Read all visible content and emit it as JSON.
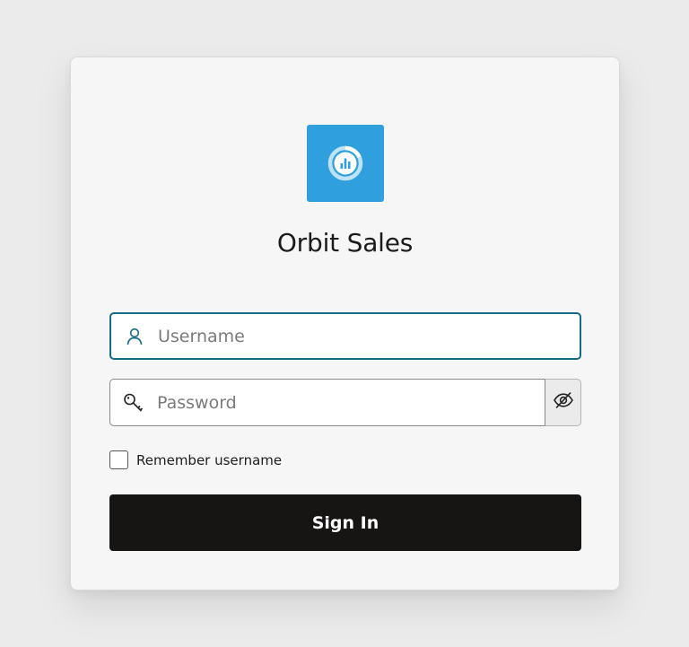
{
  "app": {
    "title": "Orbit Sales",
    "logo_icon": "orbit-chart-logo-icon",
    "brand_color": "#2f9fde"
  },
  "form": {
    "username": {
      "value": "",
      "placeholder": "Username",
      "icon": "user-icon",
      "focused": true,
      "focus_color": "#146b86"
    },
    "password": {
      "value": "",
      "placeholder": "Password",
      "icon": "key-icon",
      "toggle_icon": "eye-slash-icon"
    },
    "remember": {
      "label": "Remember username",
      "checked": false
    },
    "submit": {
      "label": "Sign In",
      "color": "#161513"
    }
  }
}
